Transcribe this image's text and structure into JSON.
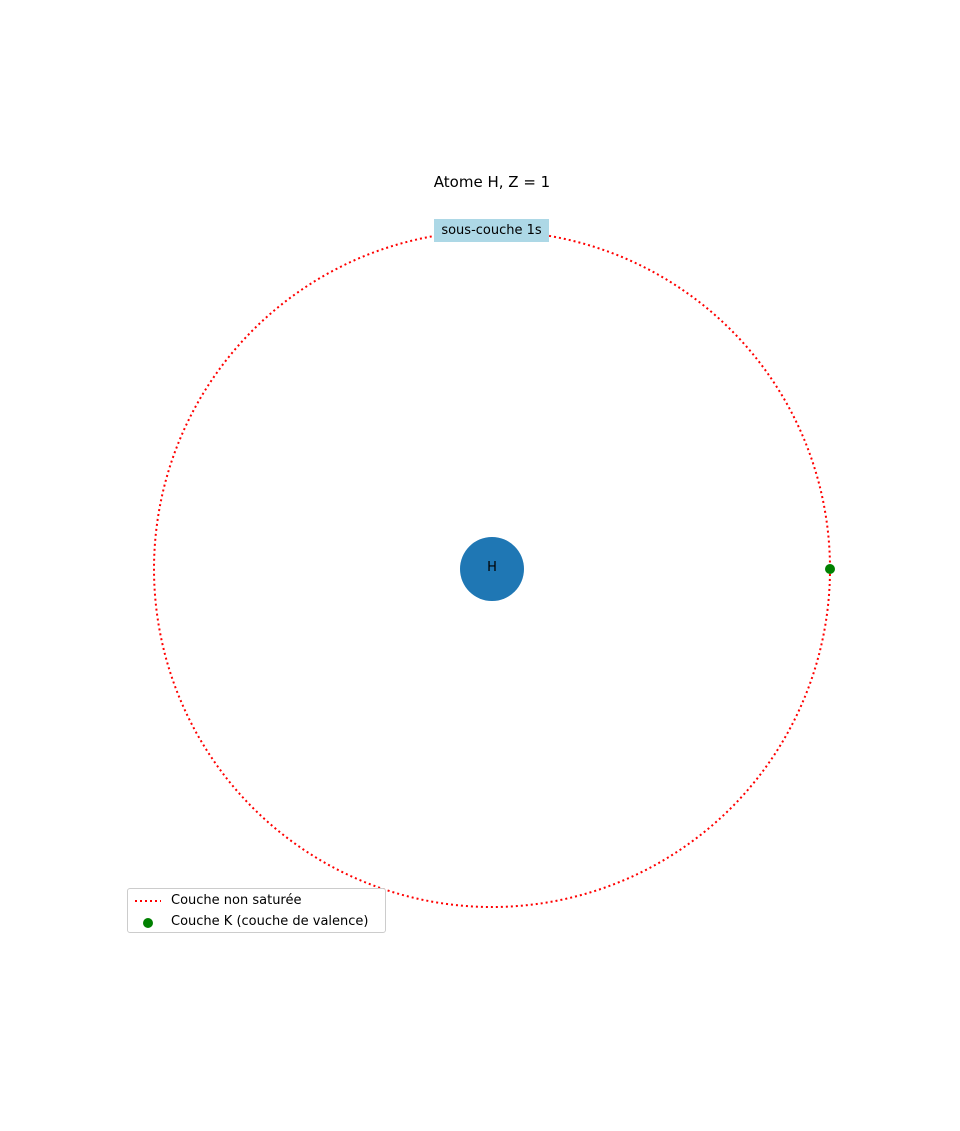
{
  "chart_data": {
    "type": "atom-diagram",
    "title": "Atome H, Z = 1",
    "nucleus": {
      "symbol": "H",
      "color": "#1f77b4"
    },
    "shells": [
      {
        "name": "K",
        "subshell_label": "sous-couche 1s",
        "label_background": "#add8e6",
        "saturated": false,
        "line_style": "dotted",
        "line_color": "#ff0000",
        "electrons": 1,
        "electron_color": "#008000"
      }
    ],
    "legend": {
      "placement": "lower-left",
      "entries": [
        {
          "label": "Couche non saturée",
          "marker": "dotted-line",
          "color": "#ff0000"
        },
        {
          "label": "Couche K (couche de valence)",
          "marker": "dot",
          "color": "#008000"
        }
      ]
    }
  }
}
